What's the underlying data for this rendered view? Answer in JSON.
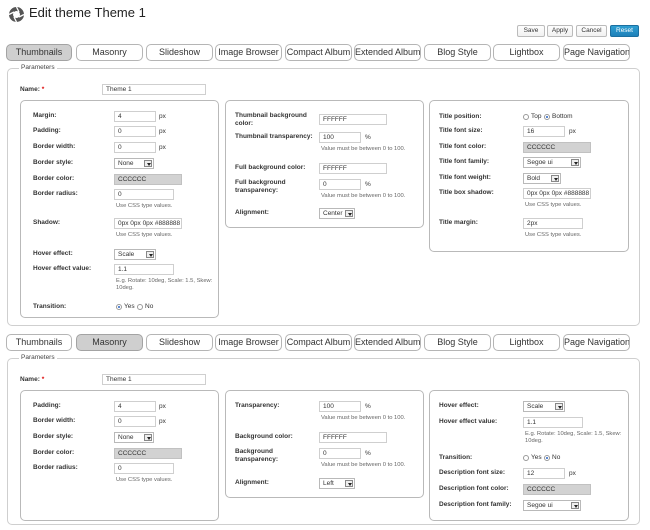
{
  "header": {
    "title": "Edit theme Theme 1",
    "logo_icon": "photo-gallery-logo-icon",
    "buttons": {
      "save": "Save",
      "apply": "Apply",
      "cancel": "Cancel",
      "reset": "Reset"
    },
    "accent_color": "#2188c3"
  },
  "tabs": [
    "Thumbnails",
    "Masonry",
    "Slideshow",
    "Image Browser",
    "Compact Album",
    "Extended Album",
    "Blog Style",
    "Lightbox",
    "Page Navigation"
  ],
  "thumbnails": {
    "legend": "Parameters",
    "name_label": "Name:",
    "required_mark": "*",
    "name_value": "Theme 1",
    "col1": {
      "margin": {
        "label": "Margin:",
        "value": "4",
        "unit": "px"
      },
      "padding": {
        "label": "Padding:",
        "value": "0",
        "unit": "px"
      },
      "border_width": {
        "label": "Border width:",
        "value": "0",
        "unit": "px"
      },
      "border_style": {
        "label": "Border style:",
        "value": "None"
      },
      "border_color": {
        "label": "Border color:",
        "value": "CCCCCC"
      },
      "border_radius": {
        "label": "Border radius:",
        "value": "0",
        "hint": "Use CSS type values."
      },
      "shadow": {
        "label": "Shadow:",
        "value": "0px 0px 0px #888888",
        "hint": "Use CSS type values."
      },
      "hover_effect": {
        "label": "Hover effect:",
        "value": "Scale"
      },
      "hover_effect_value": {
        "label": "Hover effect value:",
        "value": "1.1",
        "hint": "E.g. Rotate: 10deg, Scale: 1.5, Skew: 10deg."
      },
      "transition": {
        "label": "Transition:",
        "yes": "Yes",
        "no": "No",
        "selected": "Yes"
      }
    },
    "col2": {
      "thumb_bg_color": {
        "label": "Thumbnail background color:",
        "value": "FFFFFF"
      },
      "thumb_transparency": {
        "label": "Thumbnail transparency:",
        "value": "100",
        "unit": "%",
        "hint": "Value must be between 0 to 100."
      },
      "full_bg_color": {
        "label": "Full background color:",
        "value": "FFFFFF"
      },
      "full_bg_transparency": {
        "label": "Full background transparency:",
        "value": "0",
        "unit": "%",
        "hint": "Value must be between 0 to 100."
      },
      "alignment": {
        "label": "Alignment:",
        "value": "Center"
      }
    },
    "col3": {
      "title_position": {
        "label": "Title position:",
        "top": "Top",
        "bottom": "Bottom",
        "selected": "Bottom"
      },
      "title_font_size": {
        "label": "Title font size:",
        "value": "16",
        "unit": "px"
      },
      "title_font_color": {
        "label": "Title font color:",
        "value": "CCCCCC"
      },
      "title_font_family": {
        "label": "Title font family:",
        "value": "Segoe ui"
      },
      "title_font_weight": {
        "label": "Title font weight:",
        "value": "Bold"
      },
      "title_box_shadow": {
        "label": "Title box shadow:",
        "value": "0px 0px 0px #888888",
        "hint": "Use CSS type values."
      },
      "title_margin": {
        "label": "Title margin:",
        "value": "2px",
        "hint": "Use CSS type values."
      }
    }
  },
  "masonry": {
    "legend": "Parameters",
    "name_label": "Name:",
    "required_mark": "*",
    "name_value": "Theme 1",
    "col1": {
      "padding": {
        "label": "Padding:",
        "value": "4",
        "unit": "px"
      },
      "border_width": {
        "label": "Border width:",
        "value": "0",
        "unit": "px"
      },
      "border_style": {
        "label": "Border style:",
        "value": "None"
      },
      "border_color": {
        "label": "Border color:",
        "value": "CCCCCC"
      },
      "border_radius": {
        "label": "Border radius:",
        "value": "0",
        "hint": "Use CSS type values."
      }
    },
    "col2": {
      "transparency": {
        "label": "Transparency:",
        "value": "100",
        "unit": "%",
        "hint": "Value must be between 0 to 100."
      },
      "bg_color": {
        "label": "Background color:",
        "value": "FFFFFF"
      },
      "bg_transparency": {
        "label": "Background transparency:",
        "value": "0",
        "unit": "%",
        "hint": "Value must be between 0 to 100."
      },
      "alignment": {
        "label": "Alignment:",
        "value": "Left"
      }
    },
    "col3": {
      "hover_effect": {
        "label": "Hover effect:",
        "value": "Scale"
      },
      "hover_effect_value": {
        "label": "Hover effect value:",
        "value": "1.1",
        "hint": "E.g. Rotate: 10deg, Scale: 1.5, Skew: 10deg."
      },
      "transition": {
        "label": "Transition:",
        "yes": "Yes",
        "no": "No",
        "selected": "No"
      },
      "desc_font_size": {
        "label": "Description font size:",
        "value": "12",
        "unit": "px"
      },
      "desc_font_color": {
        "label": "Description font color:",
        "value": "CCCCCC"
      },
      "desc_font_family": {
        "label": "Description font family:",
        "value": "Segoe ui"
      }
    }
  }
}
